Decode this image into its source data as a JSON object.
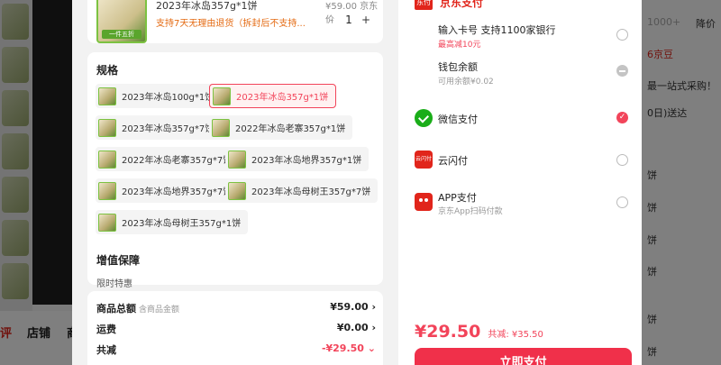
{
  "background": {
    "tabs": [
      "评",
      "店铺",
      "商"
    ],
    "right_texts": [
      "1000+",
      "降价",
      "6京豆",
      "最一站式采购！",
      "0日)送达",
      "饼",
      "饼",
      "饼",
      "饼",
      "饼",
      "饼"
    ]
  },
  "product": {
    "name": "2023年冰岛357g*1饼",
    "badge": "一件五折",
    "original_price": "¥59.00 京东价",
    "promo": "支持7天无理由退货（拆封后不支持...",
    "quantity": "1",
    "minus": "-",
    "plus": "+"
  },
  "spec": {
    "title": "规格",
    "options": [
      {
        "label": "2023年冰岛100g*1饼",
        "selected": false
      },
      {
        "label": "2023年冰岛357g*1饼",
        "selected": true
      },
      {
        "label": "2023年冰岛357g*7饼",
        "selected": false
      },
      {
        "label": "2022年冰岛老寨357g*1饼",
        "selected": false
      },
      {
        "label": "2022年冰岛老寨357g*7饼",
        "selected": false
      },
      {
        "label": "2023年冰岛地界357g*1饼",
        "selected": false
      },
      {
        "label": "2023年冰岛地界357g*7饼",
        "selected": false
      },
      {
        "label": "2023年冰岛母树王357g*7饼",
        "selected": false
      },
      {
        "label": "2023年冰岛母树王357g*1饼",
        "selected": false
      }
    ]
  },
  "vat": {
    "title": "增值保障",
    "sub": "限时特惠"
  },
  "summary": {
    "rows": [
      {
        "label": "商品总额",
        "note": "含商品金额",
        "value": "¥59.00 ›"
      },
      {
        "label": "运费",
        "note": "",
        "value": "¥0.00 ›"
      },
      {
        "label": "共减",
        "note": "",
        "value": "-¥29.50 ⌄"
      }
    ]
  },
  "payment": {
    "header": "京东支付",
    "logo_text": "东付",
    "options": [
      {
        "icon": "card-icon",
        "main": "输入卡号 支持1100家银行",
        "sub": "最高减10元",
        "sub_color": "#f2445a",
        "state": "off"
      },
      {
        "icon": "wallet-icon",
        "main": "钱包余额",
        "sub": "可用余额¥0.02",
        "sub_color": "#999999",
        "state": "disabled"
      },
      {
        "icon": "wechat-pay-icon",
        "main": "微信支付",
        "sub": "",
        "sub_color": "#999999",
        "state": "on"
      },
      {
        "icon": "unionpay-quickpass-icon",
        "main": "云闪付",
        "sub": "",
        "sub_color": "#999999",
        "state": "off"
      },
      {
        "icon": "jd-app-pay-icon",
        "main": "APP支付",
        "sub": "京东App扫码付款",
        "sub_color": "#999999",
        "state": "off"
      }
    ],
    "ysf_icon_text": "云闪付",
    "total": "¥29.50",
    "saved": "共减: ¥35.50",
    "pay_button": "立即支付",
    "accent": "#f2445a"
  }
}
